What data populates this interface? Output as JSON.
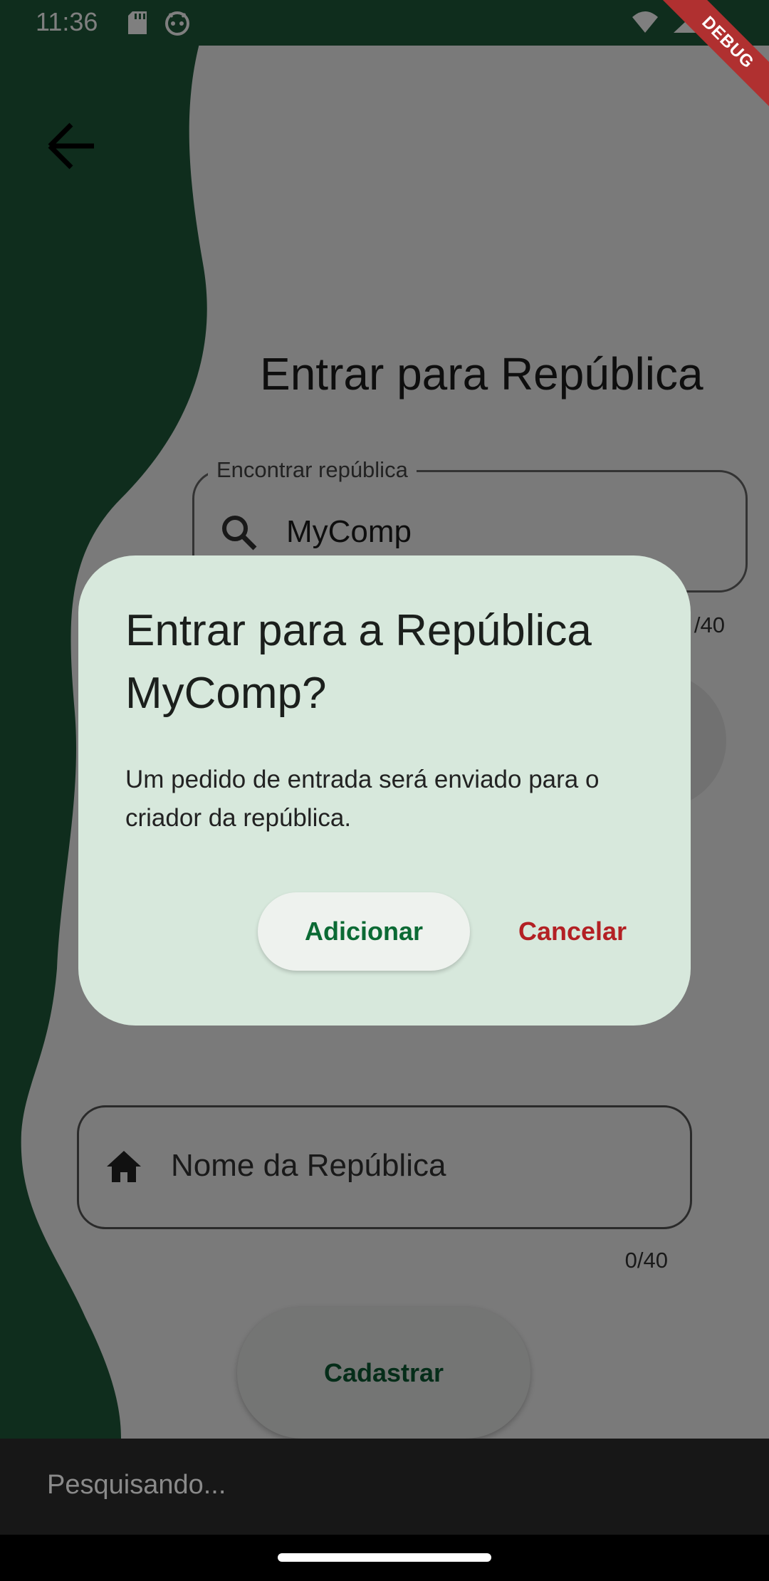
{
  "status_bar": {
    "time": "11:36",
    "left_icons": [
      "sd-card-icon",
      "android-icon"
    ],
    "right_icons": [
      "wifi-icon",
      "signal-icon"
    ]
  },
  "debug_banner": "DEBUG",
  "header": {
    "back_icon": "arrow-back-icon",
    "title": "Entrar para República"
  },
  "search_field": {
    "label": "Encontrar república",
    "value": "MyComp",
    "icon": "search-icon",
    "counter": "/40"
  },
  "register_section": {
    "field_placeholder": "Nome da República",
    "field_icon": "home-icon",
    "counter": "0/40",
    "button_label": "Cadastrar"
  },
  "dialog": {
    "title": "Entrar para a República MyComp?",
    "body": "Um pedido de entrada será enviado para o criador da república.",
    "confirm_label": "Adicionar",
    "cancel_label": "Cancelar"
  },
  "snackbar": {
    "text": "Pesquisando..."
  },
  "colors": {
    "brand_green": "#1f5a3a",
    "dialog_bg": "#d7e8dc",
    "confirm_text": "#0b6a34",
    "cancel_text": "#b32024"
  }
}
